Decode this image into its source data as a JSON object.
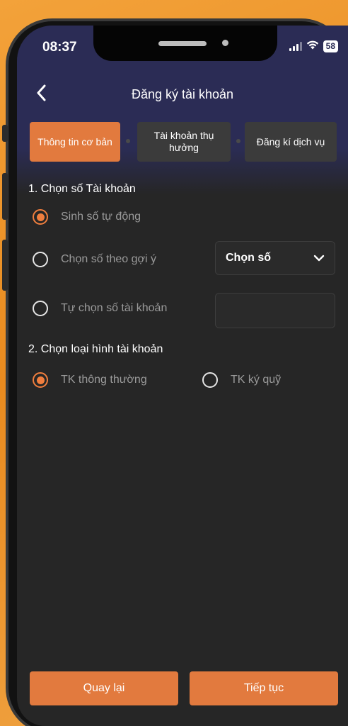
{
  "status_bar": {
    "time": "08:37",
    "battery": "58"
  },
  "header": {
    "title": "Đăng ký tài khoản",
    "back_icon": "chevron-left-icon"
  },
  "steps": [
    {
      "label": "Thông tin cơ bản",
      "active": true
    },
    {
      "label": "Tài khoản thụ hưởng",
      "active": false
    },
    {
      "label": "Đăng kí dịch vụ",
      "active": false
    }
  ],
  "section1": {
    "title": "1. Chọn số Tài khoản",
    "options": [
      {
        "label": "Sinh số tự động",
        "checked": true
      },
      {
        "label": "Chọn số theo gợi ý",
        "checked": false
      },
      {
        "label": "Tự chọn số tài khoản",
        "checked": false
      }
    ],
    "select_value": "Chọn số",
    "account_input_value": ""
  },
  "section2": {
    "title": "2. Chọn loại hình tài khoản",
    "options": [
      {
        "label": "TK thông thường",
        "checked": true
      },
      {
        "label": "TK ký quỹ",
        "checked": false
      }
    ]
  },
  "footer": {
    "back_label": "Quay lại",
    "next_label": "Tiếp tục"
  },
  "colors": {
    "accent": "#e27a3e",
    "header_bg": "#2b2c55",
    "screen_bg": "#262626"
  }
}
